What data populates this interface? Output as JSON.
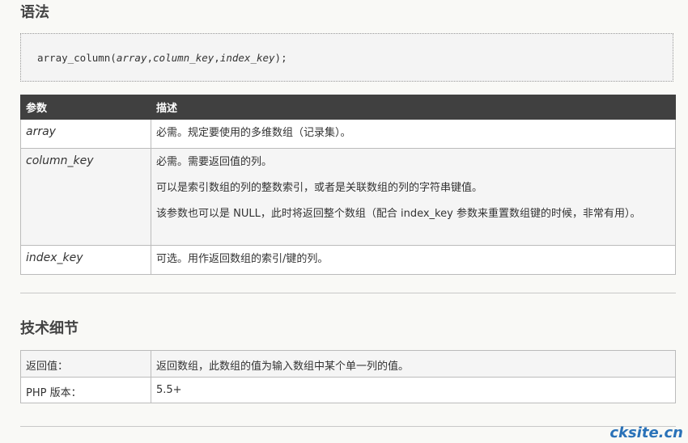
{
  "syntax": {
    "heading": "语法",
    "code": {
      "fn": "array_column(",
      "arg1": "array",
      "sep1": ",",
      "arg2": "column_key",
      "sep2": ",",
      "arg3": "index_key",
      "end": ");"
    }
  },
  "params_table": {
    "headers": [
      "参数",
      "描述"
    ],
    "rows": [
      {
        "name": "array",
        "desc": [
          "必需。规定要使用的多维数组（记录集）。"
        ]
      },
      {
        "name": "column_key",
        "desc": [
          "必需。需要返回值的列。",
          "可以是索引数组的列的整数索引，或者是关联数组的列的字符串键值。",
          "该参数也可以是 NULL，此时将返回整个数组（配合 index_key 参数来重置数组键的时候，非常有用）。"
        ]
      },
      {
        "name": "index_key",
        "desc": [
          "可选。用作返回数组的索引/键的列。"
        ]
      }
    ]
  },
  "tech": {
    "heading": "技术细节",
    "rows": [
      {
        "label": "返回值：",
        "value": "返回数组，此数组的值为输入数组中某个单一列的值。"
      },
      {
        "label": "PHP 版本：",
        "value": "5.5+"
      }
    ]
  },
  "watermark": "cksite.cn"
}
